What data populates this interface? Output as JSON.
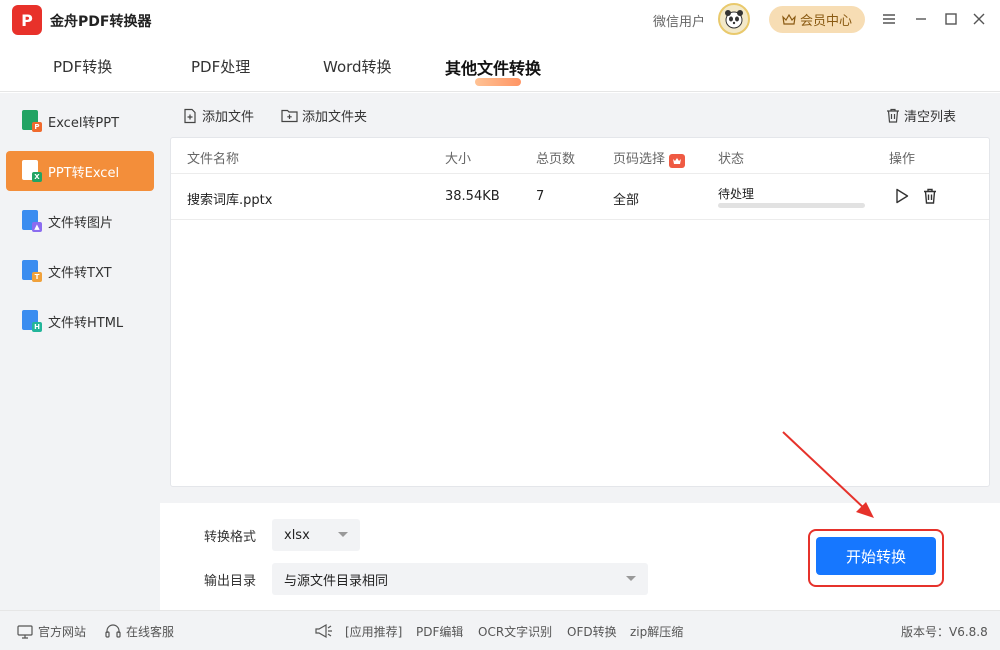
{
  "app": {
    "title": "金舟PDF转换器",
    "logo_letter": "P",
    "user_name": "微信用户",
    "member_label": "会员中心"
  },
  "nav": {
    "tabs": [
      {
        "label": "PDF转换"
      },
      {
        "label": "PDF处理"
      },
      {
        "label": "Word转换"
      },
      {
        "label": "其他文件转换"
      }
    ],
    "active_tab": "其他文件转换"
  },
  "sidebar": {
    "items": [
      {
        "label": "Excel转PPT",
        "icon": "excel-to-ppt-icon"
      },
      {
        "label": "PPT转Excel",
        "icon": "ppt-to-excel-icon"
      },
      {
        "label": "文件转图片",
        "icon": "file-to-image-icon"
      },
      {
        "label": "文件转TXT",
        "icon": "file-to-txt-icon"
      },
      {
        "label": "文件转HTML",
        "icon": "file-to-html-icon"
      }
    ],
    "active_item": "PPT转Excel"
  },
  "toolbar": {
    "add_file": "添加文件",
    "add_folder": "添加文件夹",
    "clear_list": "清空列表"
  },
  "table": {
    "headers": {
      "name": "文件名称",
      "size": "大小",
      "pages": "总页数",
      "page_select": "页码选择",
      "status": "状态",
      "actions": "操作"
    },
    "rows": [
      {
        "name": "搜索词库.pptx",
        "size": "38.54KB",
        "pages": "7",
        "page_select": "全部",
        "status": "待处理",
        "progress": 0
      }
    ]
  },
  "settings": {
    "format_label": "转换格式",
    "format_value": "xlsx",
    "output_label": "输出目录",
    "output_value": "与源文件目录相同",
    "start_button": "开始转换"
  },
  "footer": {
    "website": "官方网站",
    "support": "在线客服",
    "links": [
      "[应用推荐]",
      "PDF编辑",
      "OCR文字识别",
      "OFD转换",
      "zip解压缩"
    ],
    "version": "版本号：V6.8.8"
  },
  "colors": {
    "accent_orange": "#f38e3a",
    "primary_blue": "#1677ff",
    "highlight_red": "#e6322b",
    "logo_red": "#e8312a"
  }
}
